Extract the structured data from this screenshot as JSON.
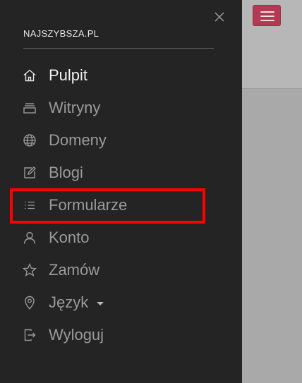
{
  "brand": "NAJSZYBSZA.PL",
  "menu": {
    "items": [
      {
        "label": "Pulpit",
        "icon": "home-icon",
        "active": true
      },
      {
        "label": "Witryny",
        "icon": "stack-icon"
      },
      {
        "label": "Domeny",
        "icon": "globe-icon"
      },
      {
        "label": "Blogi",
        "icon": "edit-icon"
      },
      {
        "label": "Formularze",
        "icon": "list-icon",
        "highlighted": true
      },
      {
        "label": "Konto",
        "icon": "user-icon"
      },
      {
        "label": "Zamów",
        "icon": "star-icon"
      },
      {
        "label": "Język",
        "icon": "map-pin-icon",
        "has_dropdown": true
      },
      {
        "label": "Wyloguj",
        "icon": "logout-icon"
      }
    ]
  },
  "colors": {
    "drawer_bg": "#242424",
    "accent": "#b33a53",
    "highlight": "#ff0000"
  }
}
